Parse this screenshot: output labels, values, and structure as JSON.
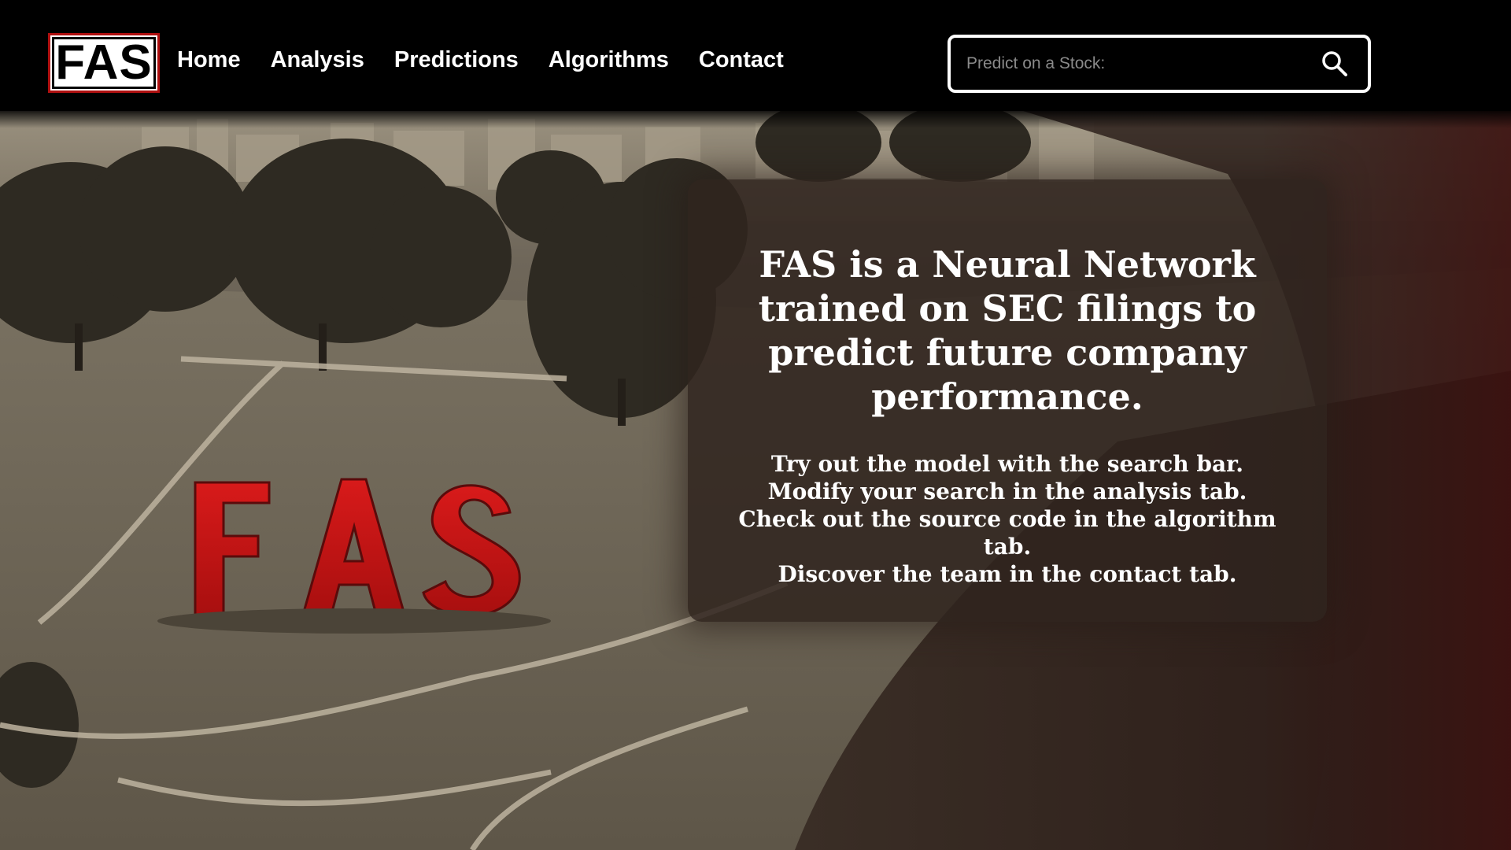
{
  "brand": {
    "logo_text": "FAS",
    "accent_color": "#b01010"
  },
  "nav": {
    "items": [
      {
        "label": "Home"
      },
      {
        "label": "Analysis"
      },
      {
        "label": "Predictions"
      },
      {
        "label": "Algorithms"
      },
      {
        "label": "Contact"
      }
    ]
  },
  "search": {
    "placeholder": "Predict on a Stock:",
    "value": "",
    "icon": "search-icon"
  },
  "hero": {
    "background": "sepia park landscape with red FAS letters",
    "sign_text": "FAS",
    "sign_color": "#c81414"
  },
  "info": {
    "heading": "FAS is a Neural Network trained on SEC filings to predict future company performance.",
    "lines": [
      "Try out the model with the search bar.",
      "Modify your search in the analysis tab.",
      "Check out the source code in the algorithm tab.",
      "Discover the team in the contact tab."
    ]
  }
}
